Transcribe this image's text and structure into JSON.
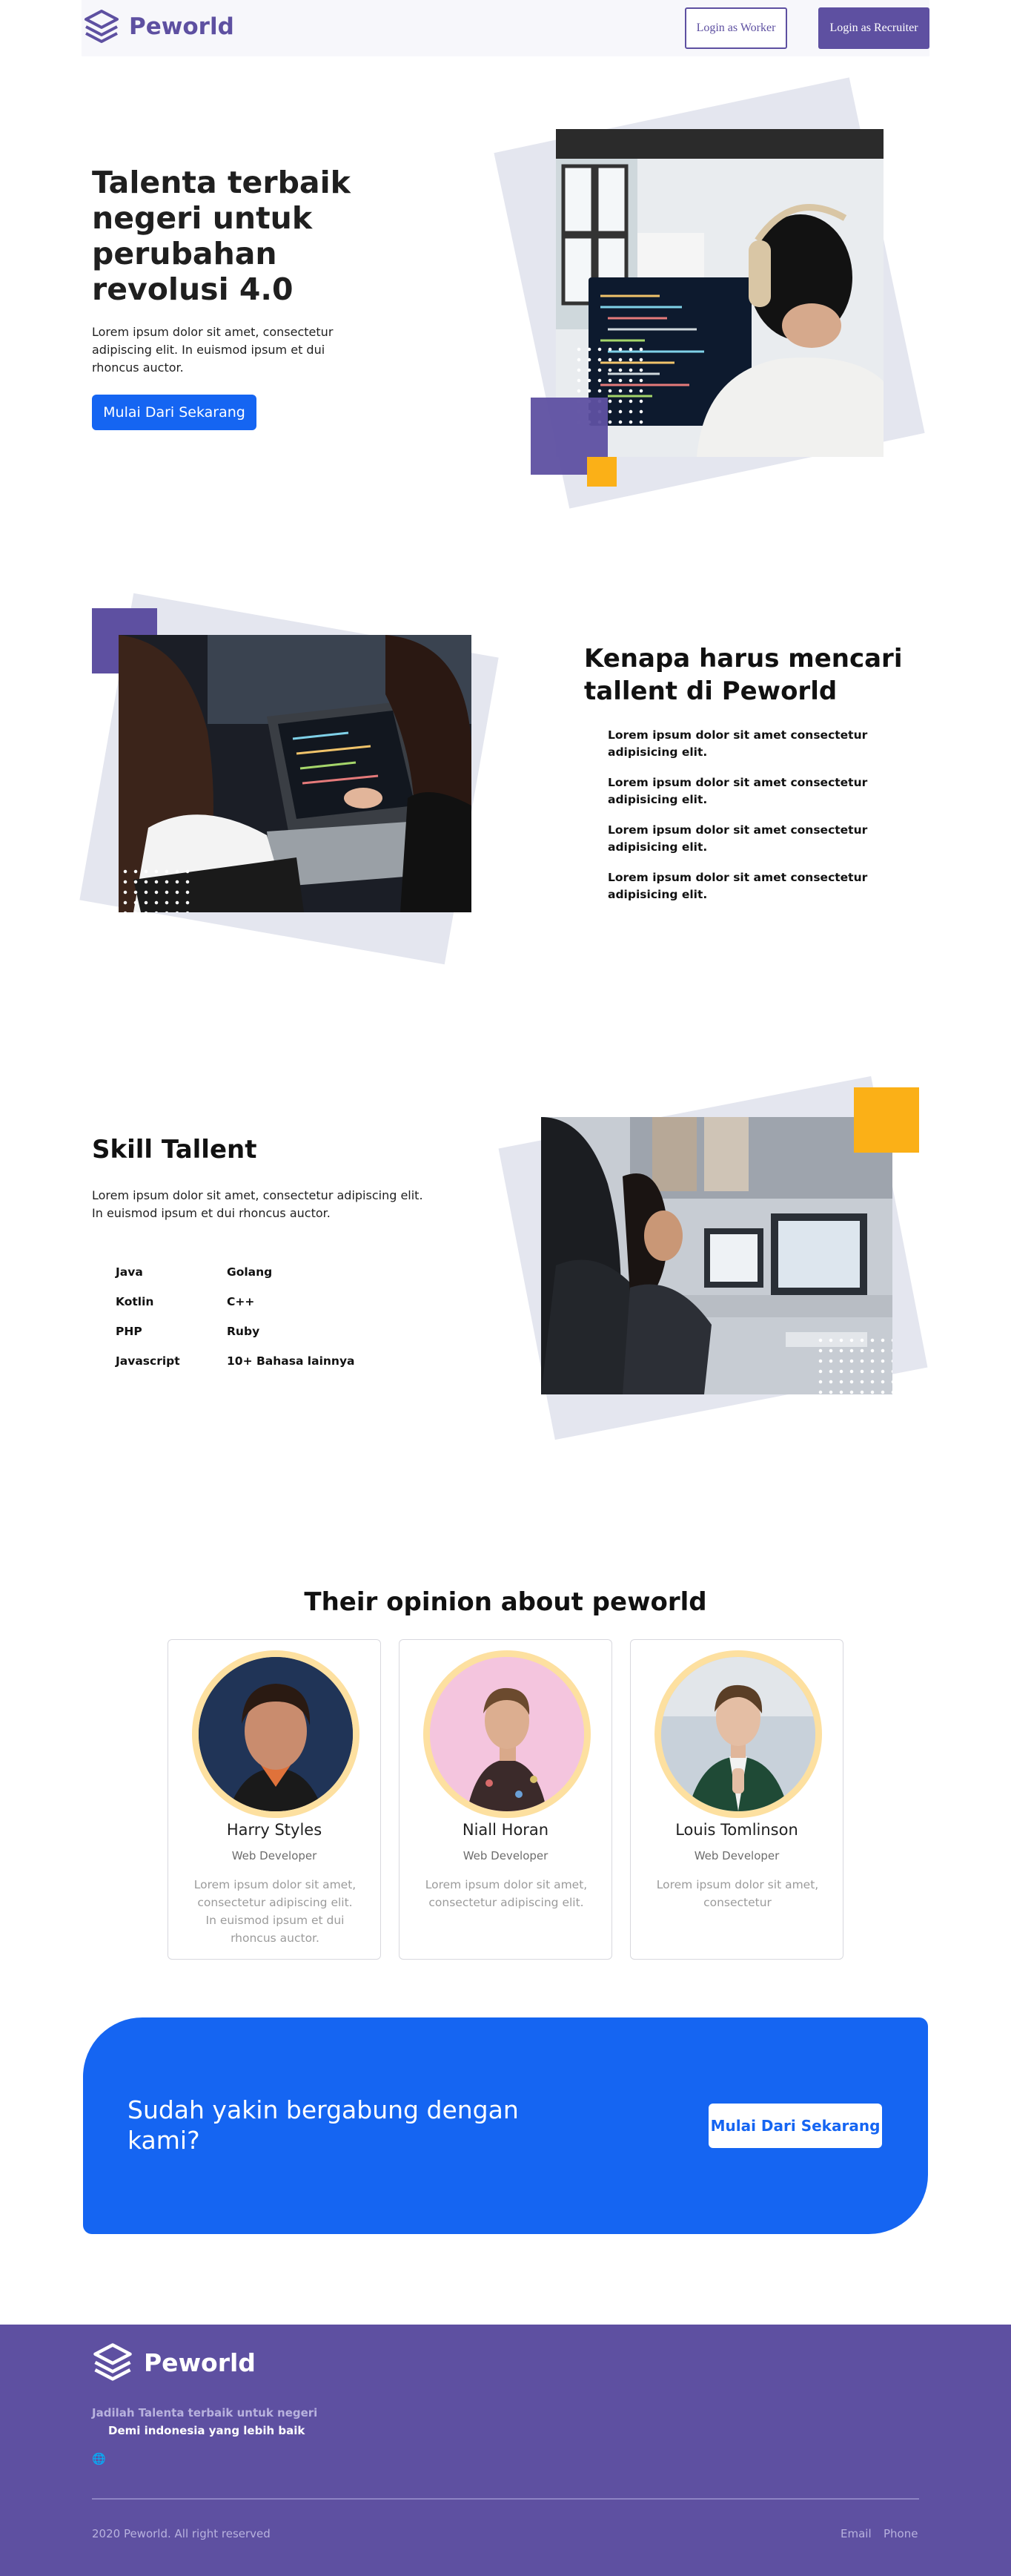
{
  "nav": {
    "brand": "Peworld",
    "login_worker": "Login as Worker",
    "login_recruiter": "Login as Recruiter"
  },
  "hero": {
    "title": "Talenta terbaik negeri untuk perubahan revolusi 4.0",
    "description": "Lorem ipsum dolor sit amet, consectetur adipiscing elit. In euismod ipsum et dui rhoncus auctor.",
    "cta": "Mulai Dari Sekarang"
  },
  "why": {
    "title": "Kenapa harus mencari tallent di Peworld",
    "points": [
      "Lorem ipsum dolor sit amet consectetur adipisicing elit.",
      "Lorem ipsum dolor sit amet consectetur adipisicing elit.",
      "Lorem ipsum dolor sit amet consectetur adipisicing elit.",
      "Lorem ipsum dolor sit amet consectetur adipisicing elit."
    ]
  },
  "skills": {
    "title": "Skill Tallent",
    "description": "Lorem ipsum dolor sit amet, consectetur adipiscing elit. In euismod ipsum et dui rhoncus auctor.",
    "left": [
      "Java",
      "Kotlin",
      "PHP",
      "Javascript"
    ],
    "right": [
      "Golang",
      "C++",
      "Ruby",
      "10+ Bahasa lainnya"
    ]
  },
  "testimonials": {
    "title": "Their opinion about peworld",
    "items": [
      {
        "name": "Harry Styles",
        "role": "Web Developer",
        "text": "Lorem ipsum dolor sit amet, consectetur adipiscing elit. In euismod ipsum et dui rhoncus auctor."
      },
      {
        "name": "Niall Horan",
        "role": "Web Developer",
        "text": "Lorem ipsum dolor sit amet, consectetur adipiscing elit."
      },
      {
        "name": "Louis Tomlinson",
        "role": "Web Developer",
        "text": "Lorem ipsum dolor sit amet, consectetur"
      }
    ]
  },
  "cta": {
    "text": "Sudah yakin bergabung dengan kami?",
    "button": "Mulai Dari Sekarang"
  },
  "footer": {
    "brand": "Peworld",
    "tagline1": "Jadilah Talenta terbaik untuk negeri",
    "tagline2": "Demi indonesia yang lebih baik",
    "globe": "🌐",
    "copyright": "2020 Peworld. All right reserved",
    "email": "Email",
    "phone": "Phone"
  },
  "colors": {
    "primary": "#5e50a1",
    "accent_blue": "#1565f2",
    "accent_yellow": "#fbb017",
    "tilt_bg": "#e4e6ef"
  },
  "icons": [
    "peworld-logo-icon",
    "globe-icon"
  ]
}
